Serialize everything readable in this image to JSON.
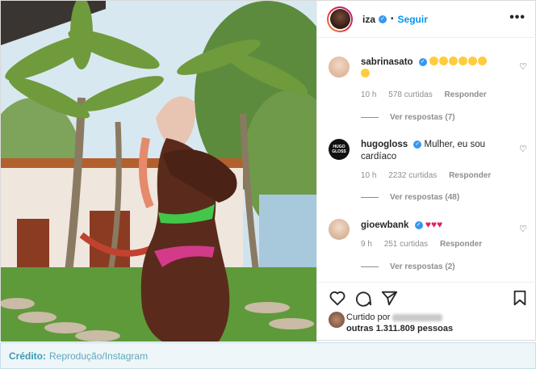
{
  "post": {
    "username": "iza",
    "separator": "•",
    "follow_label": "Seguir",
    "more_icon": "•••"
  },
  "comments": [
    {
      "username": "sabrinasato",
      "text": "",
      "emoji": "heart-eyes-emoji",
      "emoji_count": 7,
      "time": "10 h",
      "likes": "578 curtidas",
      "reply_label": "Responder",
      "replies": "Ver respostas (7)"
    },
    {
      "username": "hugogloss",
      "text": "Mulher, eu sou cardíaco",
      "avatar_text": "HUGO GLOSS",
      "time": "10 h",
      "likes": "2232 curtidas",
      "reply_label": "Responder",
      "replies": "Ver respostas (48)"
    },
    {
      "username": "gioewbank",
      "text": "♥♥♥",
      "time": "9 h",
      "likes": "251 curtidas",
      "reply_label": "Responder",
      "replies": "Ver respostas (2)"
    }
  ],
  "likes": {
    "prefix": "Curtido por",
    "others": "outras 1.311.809 pessoas"
  },
  "credit": {
    "label": "Crédito:",
    "value": "Reprodução/Instagram"
  },
  "colors": {
    "accent": "#0095f6",
    "verified": "#3897f0",
    "credit_label": "#3a9ab5",
    "credit_bg": "#eef6f9"
  }
}
